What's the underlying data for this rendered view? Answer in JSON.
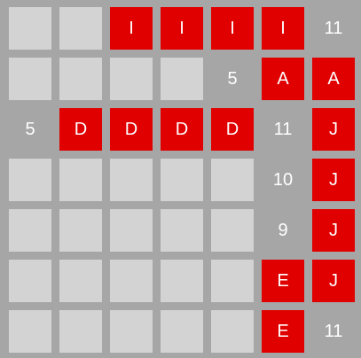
{
  "grid": {
    "rows": [
      [
        {
          "kind": "empty",
          "text": ""
        },
        {
          "kind": "empty",
          "text": ""
        },
        {
          "kind": "red",
          "text": "I"
        },
        {
          "kind": "red",
          "text": "I"
        },
        {
          "kind": "red",
          "text": "I"
        },
        {
          "kind": "red",
          "text": "I"
        },
        {
          "kind": "number",
          "text": "11"
        }
      ],
      [
        {
          "kind": "empty",
          "text": ""
        },
        {
          "kind": "empty",
          "text": ""
        },
        {
          "kind": "empty",
          "text": ""
        },
        {
          "kind": "empty",
          "text": ""
        },
        {
          "kind": "number",
          "text": "5"
        },
        {
          "kind": "red",
          "text": "A"
        },
        {
          "kind": "red",
          "text": "A"
        }
      ],
      [
        {
          "kind": "number",
          "text": "5"
        },
        {
          "kind": "red",
          "text": "D"
        },
        {
          "kind": "red",
          "text": "D"
        },
        {
          "kind": "red",
          "text": "D"
        },
        {
          "kind": "red",
          "text": "D"
        },
        {
          "kind": "number",
          "text": "11"
        },
        {
          "kind": "red",
          "text": "J"
        }
      ],
      [
        {
          "kind": "empty",
          "text": ""
        },
        {
          "kind": "empty",
          "text": ""
        },
        {
          "kind": "empty",
          "text": ""
        },
        {
          "kind": "empty",
          "text": ""
        },
        {
          "kind": "empty",
          "text": ""
        },
        {
          "kind": "number",
          "text": "10"
        },
        {
          "kind": "red",
          "text": "J"
        }
      ],
      [
        {
          "kind": "empty",
          "text": ""
        },
        {
          "kind": "empty",
          "text": ""
        },
        {
          "kind": "empty",
          "text": ""
        },
        {
          "kind": "empty",
          "text": ""
        },
        {
          "kind": "empty",
          "text": ""
        },
        {
          "kind": "number",
          "text": "9"
        },
        {
          "kind": "red",
          "text": "J"
        }
      ],
      [
        {
          "kind": "empty",
          "text": ""
        },
        {
          "kind": "empty",
          "text": ""
        },
        {
          "kind": "empty",
          "text": ""
        },
        {
          "kind": "empty",
          "text": ""
        },
        {
          "kind": "empty",
          "text": ""
        },
        {
          "kind": "red",
          "text": "E"
        },
        {
          "kind": "red",
          "text": "J"
        }
      ],
      [
        {
          "kind": "empty",
          "text": ""
        },
        {
          "kind": "empty",
          "text": ""
        },
        {
          "kind": "empty",
          "text": ""
        },
        {
          "kind": "empty",
          "text": ""
        },
        {
          "kind": "empty",
          "text": ""
        },
        {
          "kind": "red",
          "text": "E"
        },
        {
          "kind": "number",
          "text": "11"
        }
      ]
    ]
  },
  "colors": {
    "background": "#a6a6a6",
    "empty_cell": "#d3d3d3",
    "red_block": "#e00000",
    "text": "#ffffff"
  }
}
